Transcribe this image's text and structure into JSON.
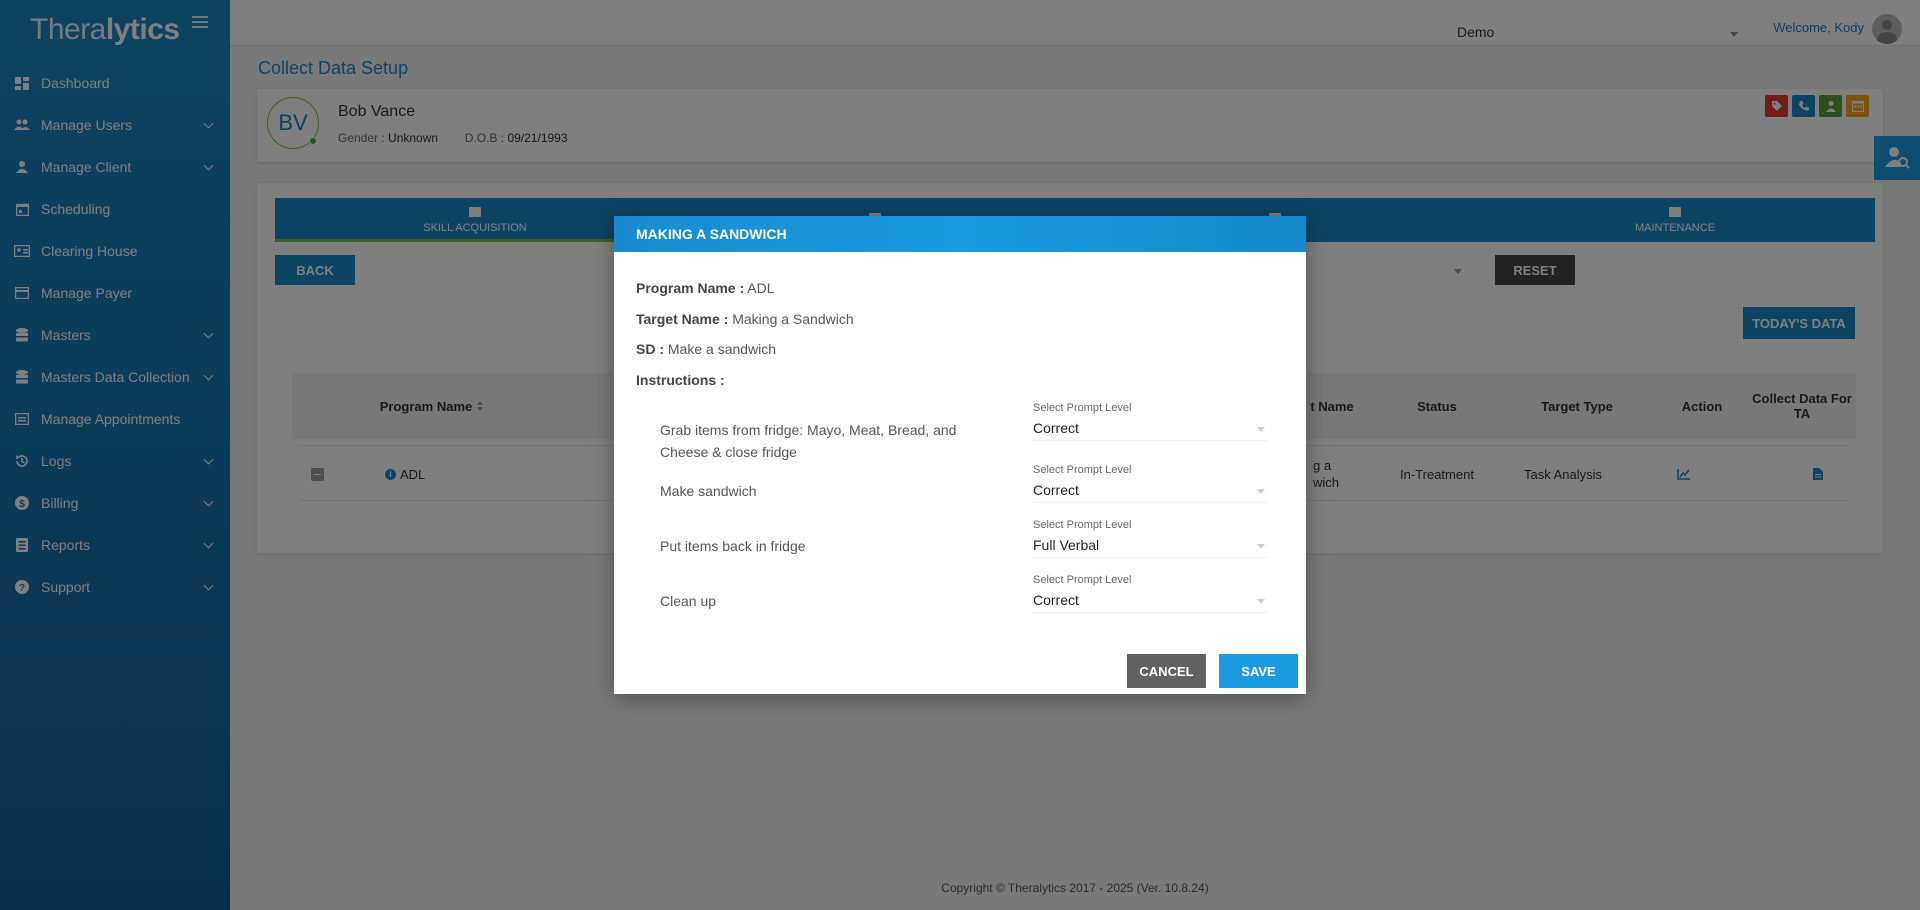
{
  "app": {
    "logo_light": "Thera",
    "logo_bold": "lytics"
  },
  "sidebar": {
    "items": [
      {
        "label": "Dashboard",
        "icon": "dashboard-icon",
        "expandable": false
      },
      {
        "label": "Manage Users",
        "icon": "users-icon",
        "expandable": true
      },
      {
        "label": "Manage Client",
        "icon": "person-icon",
        "expandable": true
      },
      {
        "label": "Scheduling",
        "icon": "calendar-icon",
        "expandable": false
      },
      {
        "label": "Clearing House",
        "icon": "id-card-icon",
        "expandable": false
      },
      {
        "label": "Manage Payer",
        "icon": "payer-icon",
        "expandable": false
      },
      {
        "label": "Masters",
        "icon": "database-icon",
        "expandable": true
      },
      {
        "label": "Masters Data Collection",
        "icon": "database-icon",
        "expandable": true
      },
      {
        "label": "Manage Appointments",
        "icon": "appointment-icon",
        "expandable": false
      },
      {
        "label": "Logs",
        "icon": "history-icon",
        "expandable": true
      },
      {
        "label": "Billing",
        "icon": "dollar-icon",
        "expandable": true
      },
      {
        "label": "Reports",
        "icon": "report-icon",
        "expandable": true
      },
      {
        "label": "Support",
        "icon": "help-icon",
        "expandable": true
      }
    ]
  },
  "header": {
    "org": "Demo",
    "welcome": "Welcome, Kody"
  },
  "page": {
    "title": "Collect Data Setup"
  },
  "client": {
    "initials": "BV",
    "name": "Bob Vance",
    "gender_label": "Gender :",
    "gender": "Unknown",
    "dob_label": "D.O.B :",
    "dob": "09/21/1993",
    "action_colors": [
      "#e53935",
      "#1a88c9",
      "#5aa03a",
      "#f5a623"
    ]
  },
  "tabs": [
    {
      "label": "SKILL ACQUISITION",
      "active": true
    },
    {
      "label": "",
      "active": false
    },
    {
      "label": "",
      "active": false
    },
    {
      "label": "MAINTENANCE",
      "active": false
    }
  ],
  "buttons": {
    "back": "BACK",
    "reset": "RESET",
    "todays_data": "TODAY'S DATA"
  },
  "grid": {
    "headers": {
      "program_name": "Program Name",
      "target_name_partial": "t Name",
      "status": "Status",
      "target_type": "Target Type",
      "action": "Action",
      "collect_ta": "Collect Data For TA"
    },
    "row": {
      "program": "ADL",
      "target_partial_1": "g a",
      "target_partial_2": "wich",
      "status": "In-Treatment",
      "target_type": "Task Analysis"
    }
  },
  "footer": {
    "copyright": "Copyright © Theralytics 2017 - 2025 (Ver. 10.8.24)"
  },
  "modal": {
    "title": "MAKING A SANDWICH",
    "program_label": "Program Name :",
    "program_value": "ADL",
    "target_label": "Target Name :",
    "target_value": "Making a Sandwich",
    "sd_label": "SD :",
    "sd_value": "Make a sandwich",
    "instructions_label": "Instructions :",
    "prompt_label": "Select Prompt Level",
    "steps": [
      {
        "text": "Grab items from fridge: Mayo, Meat, Bread, and Cheese & close fridge",
        "prompt": "Correct"
      },
      {
        "text": "Make sandwich",
        "prompt": "Correct"
      },
      {
        "text": "Put items back in fridge",
        "prompt": "Full Verbal"
      },
      {
        "text": "Clean up",
        "prompt": "Correct"
      }
    ],
    "cancel": "CANCEL",
    "save": "SAVE"
  }
}
